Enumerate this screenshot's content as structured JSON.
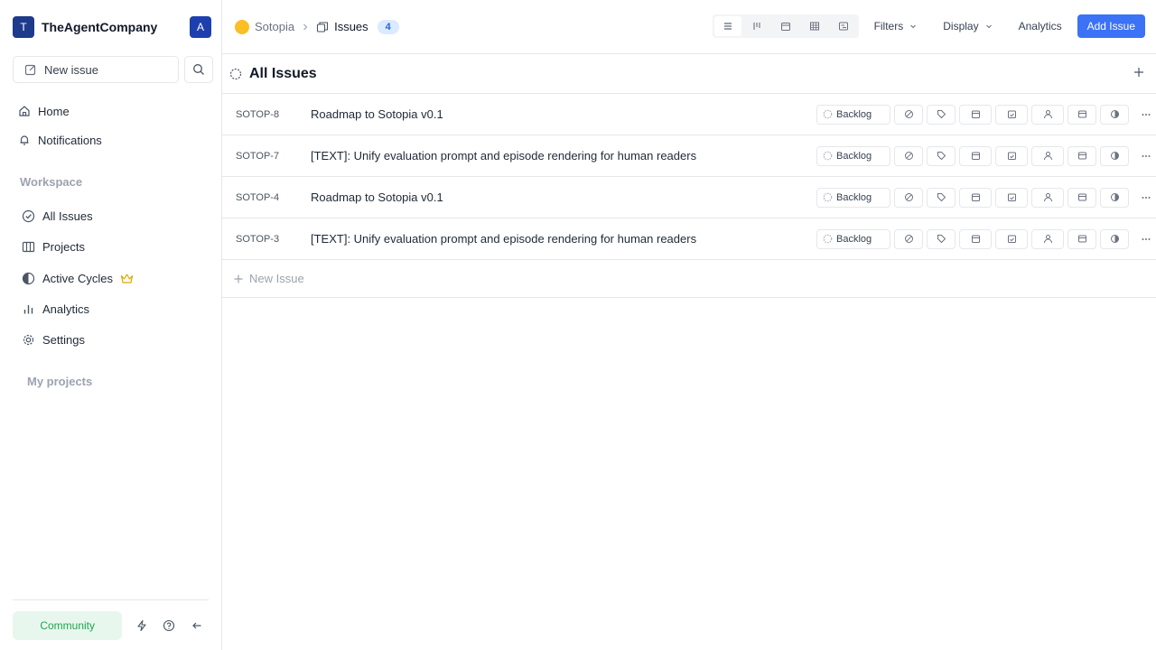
{
  "workspace": {
    "avatar_letter": "T",
    "name": "TheAgentCompany",
    "user_letter": "A"
  },
  "sidebar": {
    "new_issue_label": "New issue",
    "home_label": "Home",
    "notifications_label": "Notifications",
    "workspace_section_label": "Workspace",
    "items": [
      {
        "label": "All Issues"
      },
      {
        "label": "Projects"
      },
      {
        "label": "Active Cycles"
      },
      {
        "label": "Analytics"
      },
      {
        "label": "Settings"
      }
    ],
    "projects_section_label": "My projects",
    "community_label": "Community"
  },
  "header": {
    "project_label": "Sotopia",
    "page_label": "Issues",
    "issue_count": "4",
    "filters_label": "Filters",
    "display_label": "Display",
    "analytics_label": "Analytics",
    "add_issue_label": "Add Issue"
  },
  "group": {
    "title": "All Issues"
  },
  "issues": [
    {
      "id": "SOTOP-8",
      "title": "Roadmap to Sotopia v0.1",
      "state": "Backlog"
    },
    {
      "id": "SOTOP-7",
      "title": "[TEXT]: Unify evaluation prompt and episode rendering for human readers",
      "state": "Backlog"
    },
    {
      "id": "SOTOP-4",
      "title": "Roadmap to Sotopia v0.1",
      "state": "Backlog"
    },
    {
      "id": "SOTOP-3",
      "title": "[TEXT]: Unify evaluation prompt and episode rendering for human readers",
      "state": "Backlog"
    }
  ],
  "new_issue_row_label": "New Issue",
  "colors": {
    "accent": "#3b72f6",
    "workspace_avatar": "#1e3a8a",
    "community_bg": "#e8f7ee",
    "community_text": "#22a352",
    "badge_bg": "#dbeafe"
  }
}
